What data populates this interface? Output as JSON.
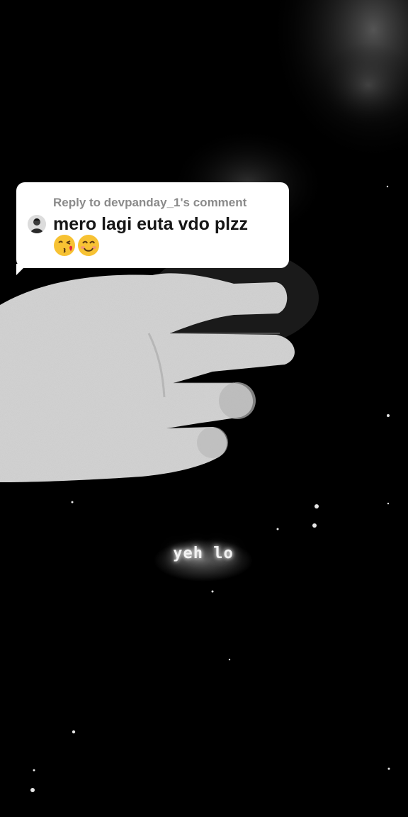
{
  "reply": {
    "header": "Reply to devpanday_1's comment",
    "comment": "mero lagi euta vdo plzz",
    "emojis": [
      "face-blowing-kiss-emoji",
      "smiling-face-emoji"
    ]
  },
  "caption": "yeh lo",
  "colors": {
    "background": "#000000",
    "bubble": "#ffffff",
    "header_text": "#8a8a8a",
    "comment_text": "#161616",
    "emoji_yellow": "#f7c233"
  }
}
